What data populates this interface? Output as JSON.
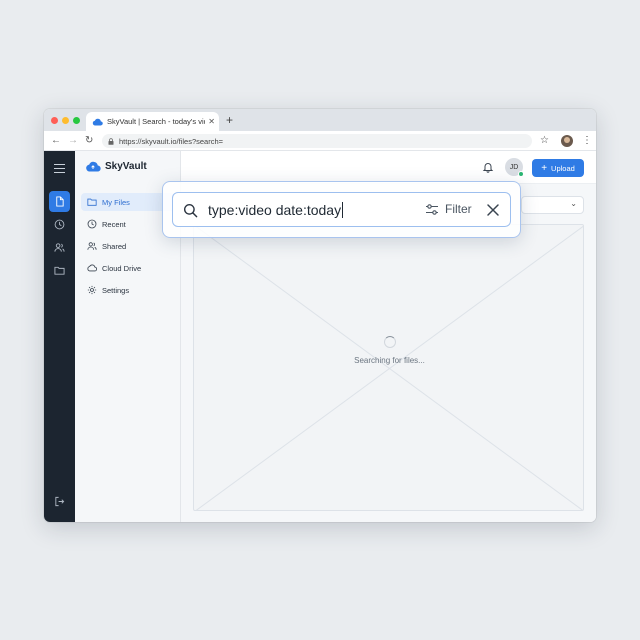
{
  "browser": {
    "tab_title": "SkyVault | Search - today's video",
    "tab_close": "✕",
    "new_tab": "+",
    "url": "https://skyvault.io/files?search=",
    "nav_back": "←",
    "nav_forward": "→",
    "nav_reload": "↻",
    "star": "☆",
    "menu": "⋮"
  },
  "app": {
    "brand": "SkyVault",
    "accent_color": "#2f7be5"
  },
  "rail": {
    "items": [
      {
        "icon": "file-icon",
        "active": true
      },
      {
        "icon": "clock-icon",
        "active": false
      },
      {
        "icon": "users-icon",
        "active": false
      },
      {
        "icon": "folder-icon",
        "active": false
      }
    ],
    "bottom_icon": "logout-icon"
  },
  "sidebar": {
    "items": [
      {
        "label": "My Files",
        "icon": "folder-icon",
        "active": true
      },
      {
        "label": "Recent",
        "icon": "clock-icon",
        "active": false
      },
      {
        "label": "Shared",
        "icon": "users-icon",
        "active": false
      },
      {
        "label": "Cloud Drive",
        "icon": "cloud-icon",
        "active": false
      },
      {
        "label": "Settings",
        "icon": "gear-icon",
        "active": false
      }
    ]
  },
  "header": {
    "avatar_initials": "JD",
    "upload_plus": "+",
    "upload_label": "Upload"
  },
  "main": {
    "sort_chevron": "⌄",
    "loading_text": "Searching for files..."
  },
  "search": {
    "value": "type:video date:today",
    "filter_label": "Filter"
  }
}
